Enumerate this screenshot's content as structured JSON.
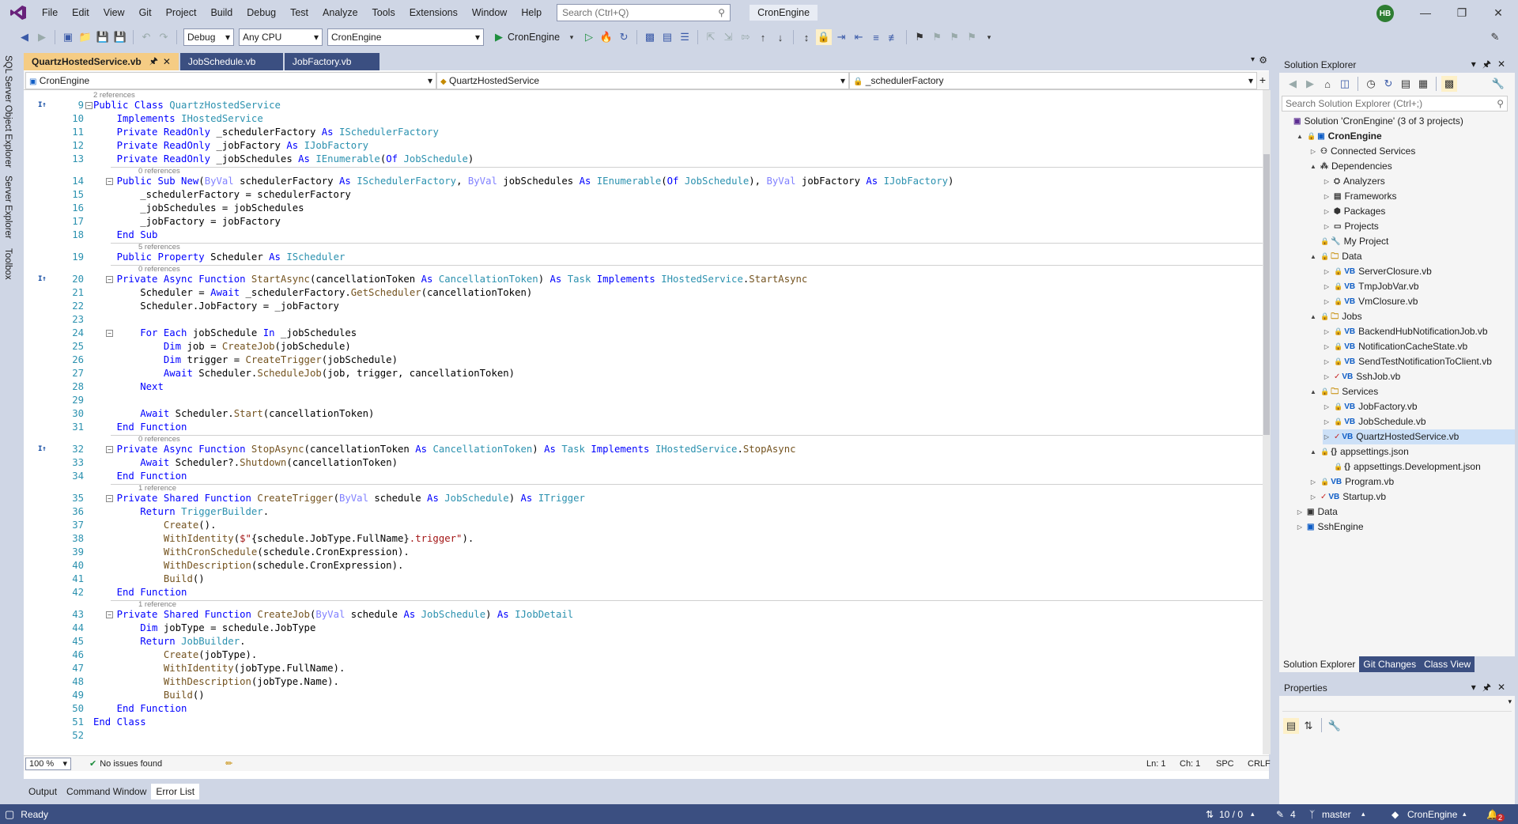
{
  "menu": [
    "File",
    "Edit",
    "View",
    "Git",
    "Project",
    "Build",
    "Debug",
    "Test",
    "Analyze",
    "Tools",
    "Extensions",
    "Window",
    "Help"
  ],
  "search_placeholder": "Search (Ctrl+Q)",
  "solution_badge": "CronEngine",
  "avatar": "HB",
  "toolbar": {
    "config": "Debug",
    "platform": "Any CPU",
    "startup_project": "CronEngine",
    "run_label": "CronEngine"
  },
  "left_tabs": [
    "SQL Server Object Explorer",
    "Server Explorer",
    "Toolbox"
  ],
  "doc_tabs": [
    "QuartzHostedService.vb",
    "JobSchedule.vb",
    "JobFactory.vb"
  ],
  "nav": {
    "project": "CronEngine",
    "type": "QuartzHostedService",
    "member": "_schedulerFactory"
  },
  "code_lines": [
    {
      "n": "9",
      "ref": "2 references",
      "html": "<span class='kw'>Public Class</span> <span class='ty'>QuartzHostedService</span>"
    },
    {
      "n": "10",
      "html": "    <span class='kw'>Implements</span> <span class='ty'>IHostedService</span>"
    },
    {
      "n": "11",
      "html": "    <span class='kw'>Private ReadOnly</span> _schedulerFactory <span class='kw'>As</span> <span class='ty'>ISchedulerFactory</span>"
    },
    {
      "n": "12",
      "html": "    <span class='kw'>Private ReadOnly</span> _jobFactory <span class='kw'>As</span> <span class='ty'>IJobFactory</span>"
    },
    {
      "n": "13",
      "html": "    <span class='kw'>Private ReadOnly</span> _jobSchedules <span class='kw'>As</span> <span class='ty'>IEnumerable</span>(<span class='kw'>Of</span> <span class='ty'>JobSchedule</span>)"
    },
    {
      "n": "14",
      "ref": "0 references",
      "html": "    <span class='kw'>Public Sub New</span>(<span class='dim'>ByVal</span> schedulerFactory <span class='kw'>As</span> <span class='ty'>ISchedulerFactory</span>, <span class='dim'>ByVal</span> jobSchedules <span class='kw'>As</span> <span class='ty'>IEnumerable</span>(<span class='kw'>Of</span> <span class='ty'>JobSchedule</span>), <span class='dim'>ByVal</span> jobFactory <span class='kw'>As</span> <span class='ty'>IJobFactory</span>)"
    },
    {
      "n": "15",
      "html": "        _schedulerFactory = schedulerFactory"
    },
    {
      "n": "16",
      "html": "        _jobSchedules = jobSchedules"
    },
    {
      "n": "17",
      "html": "        _jobFactory = jobFactory"
    },
    {
      "n": "18",
      "html": "    <span class='kw'>End Sub</span>"
    },
    {
      "n": "19",
      "ref": "5 references",
      "html": "    <span class='kw'>Public Property</span> Scheduler <span class='kw'>As</span> <span class='ty'>IScheduler</span>"
    },
    {
      "n": "20",
      "ref": "0 references",
      "html": "    <span class='kw'>Private Async Function</span> <span class='fn'>StartAsync</span>(cancellationToken <span class='kw'>As</span> <span class='ty'>CancellationToken</span>) <span class='kw'>As</span> <span class='ty'>Task</span> <span class='kw'>Implements</span> <span class='ty'>IHostedService</span>.<span class='fn'>StartAsync</span>"
    },
    {
      "n": "21",
      "html": "        Scheduler = <span class='kw'>Await</span> _schedulerFactory.<span class='fn'>GetScheduler</span>(cancellationToken)"
    },
    {
      "n": "22",
      "html": "        Scheduler.JobFactory = _jobFactory"
    },
    {
      "n": "23",
      "html": ""
    },
    {
      "n": "24",
      "html": "        <span class='kw'>For Each</span> jobSchedule <span class='kw'>In</span> _jobSchedules"
    },
    {
      "n": "25",
      "html": "            <span class='kw'>Dim</span> job = <span class='fn'>CreateJob</span>(jobSchedule)"
    },
    {
      "n": "26",
      "html": "            <span class='kw'>Dim</span> trigger = <span class='fn'>CreateTrigger</span>(jobSchedule)"
    },
    {
      "n": "27",
      "html": "            <span class='kw'>Await</span> Scheduler.<span class='fn'>ScheduleJob</span>(job, trigger, cancellationToken)"
    },
    {
      "n": "28",
      "html": "        <span class='kw'>Next</span>"
    },
    {
      "n": "29",
      "html": ""
    },
    {
      "n": "30",
      "html": "        <span class='kw'>Await</span> Scheduler.<span class='fn'>Start</span>(cancellationToken)"
    },
    {
      "n": "31",
      "html": "    <span class='kw'>End Function</span>"
    },
    {
      "n": "32",
      "ref": "0 references",
      "html": "    <span class='kw'>Private Async Function</span> <span class='fn'>StopAsync</span>(cancellationToken <span class='kw'>As</span> <span class='ty'>CancellationToken</span>) <span class='kw'>As</span> <span class='ty'>Task</span> <span class='kw'>Implements</span> <span class='ty'>IHostedService</span>.<span class='fn'>StopAsync</span>"
    },
    {
      "n": "33",
      "html": "        <span class='kw'>Await</span> Scheduler?.<span class='fn'>Shutdown</span>(cancellationToken)"
    },
    {
      "n": "34",
      "html": "    <span class='kw'>End Function</span>"
    },
    {
      "n": "35",
      "ref": "1 reference",
      "html": "    <span class='kw'>Private Shared Function</span> <span class='fn'>CreateTrigger</span>(<span class='dim'>ByVal</span> schedule <span class='kw'>As</span> <span class='ty'>JobSchedule</span>) <span class='kw'>As</span> <span class='ty'>ITrigger</span>"
    },
    {
      "n": "36",
      "html": "        <span class='kw'>Return</span> <span class='ty'>TriggerBuilder</span>."
    },
    {
      "n": "37",
      "html": "            <span class='fn'>Create</span>()."
    },
    {
      "n": "38",
      "html": "            <span class='fn'>WithIdentity</span>(<span class='st'>$\"</span>{schedule.JobType.FullName}<span class='st'>.trigger\"</span>)."
    },
    {
      "n": "39",
      "html": "            <span class='fn'>WithCronSchedule</span>(schedule.CronExpression)."
    },
    {
      "n": "40",
      "html": "            <span class='fn'>WithDescription</span>(schedule.CronExpression)."
    },
    {
      "n": "41",
      "html": "            <span class='fn'>Build</span>()"
    },
    {
      "n": "42",
      "html": "    <span class='kw'>End Function</span>"
    },
    {
      "n": "43",
      "ref": "1 reference",
      "html": "    <span class='kw'>Private Shared Function</span> <span class='fn'>CreateJob</span>(<span class='dim'>ByVal</span> schedule <span class='kw'>As</span> <span class='ty'>JobSchedule</span>) <span class='kw'>As</span> <span class='ty'>IJobDetail</span>"
    },
    {
      "n": "44",
      "html": "        <span class='kw'>Dim</span> jobType = schedule.JobType"
    },
    {
      "n": "45",
      "html": "        <span class='kw'>Return</span> <span class='ty'>JobBuilder</span>."
    },
    {
      "n": "46",
      "html": "            <span class='fn'>Create</span>(jobType)."
    },
    {
      "n": "47",
      "html": "            <span class='fn'>WithIdentity</span>(jobType.FullName)."
    },
    {
      "n": "48",
      "html": "            <span class='fn'>WithDescription</span>(jobType.Name)."
    },
    {
      "n": "49",
      "html": "            <span class='fn'>Build</span>()"
    },
    {
      "n": "50",
      "html": "    <span class='kw'>End Function</span>"
    },
    {
      "n": "51",
      "html": "<span class='kw'>End Class</span>"
    },
    {
      "n": "52",
      "html": ""
    }
  ],
  "editor_status": {
    "zoom": "100 %",
    "issues": "No issues found",
    "ln": "Ln: 1",
    "ch": "Ch: 1",
    "spc": "SPC",
    "crlf": "CRLF"
  },
  "bottom_tabs": [
    "Output",
    "Command Window",
    "Error List"
  ],
  "solution_explorer": {
    "title": "Solution Explorer",
    "search": "Search Solution Explorer (Ctrl+;)",
    "tree": [
      {
        "d": 0,
        "e": "",
        "icon": "sln",
        "label": "Solution 'CronEngine' (3 of 3 projects)"
      },
      {
        "d": 1,
        "e": "▲",
        "icon": "proj",
        "label": "CronEngine",
        "bold": true
      },
      {
        "d": 2,
        "e": "▷",
        "icon": "conn",
        "label": "Connected Services"
      },
      {
        "d": 2,
        "e": "▲",
        "icon": "dep",
        "label": "Dependencies"
      },
      {
        "d": 3,
        "e": "▷",
        "icon": "an",
        "label": "Analyzers"
      },
      {
        "d": 3,
        "e": "▷",
        "icon": "fw",
        "label": "Frameworks"
      },
      {
        "d": 3,
        "e": "▷",
        "icon": "pkg",
        "label": "Packages"
      },
      {
        "d": 3,
        "e": "▷",
        "icon": "prj",
        "label": "Projects"
      },
      {
        "d": 2,
        "e": "",
        "icon": "wrench",
        "label": "My Project"
      },
      {
        "d": 2,
        "e": "▲",
        "icon": "folder",
        "label": "Data"
      },
      {
        "d": 3,
        "e": "▷",
        "icon": "vb",
        "label": "ServerClosure.vb"
      },
      {
        "d": 3,
        "e": "▷",
        "icon": "vb",
        "label": "TmpJobVar.vb"
      },
      {
        "d": 3,
        "e": "▷",
        "icon": "vb",
        "label": "VmClosure.vb"
      },
      {
        "d": 2,
        "e": "▲",
        "icon": "folder",
        "label": "Jobs"
      },
      {
        "d": 3,
        "e": "▷",
        "icon": "vb",
        "label": "BackendHubNotificationJob.vb"
      },
      {
        "d": 3,
        "e": "▷",
        "icon": "vb",
        "label": "NotificationCacheState.vb"
      },
      {
        "d": 3,
        "e": "▷",
        "icon": "vb",
        "label": "SendTestNotificationToClient.vb"
      },
      {
        "d": 3,
        "e": "▷",
        "icon": "vbc",
        "label": "SshJob.vb"
      },
      {
        "d": 2,
        "e": "▲",
        "icon": "folder",
        "label": "Services"
      },
      {
        "d": 3,
        "e": "▷",
        "icon": "vb",
        "label": "JobFactory.vb"
      },
      {
        "d": 3,
        "e": "▷",
        "icon": "vb",
        "label": "JobSchedule.vb"
      },
      {
        "d": 3,
        "e": "▷",
        "icon": "vbc",
        "label": "QuartzHostedService.vb",
        "sel": true
      },
      {
        "d": 2,
        "e": "▲",
        "icon": "json",
        "label": "appsettings.json"
      },
      {
        "d": 3,
        "e": "",
        "icon": "json",
        "label": "appsettings.Development.json"
      },
      {
        "d": 2,
        "e": "▷",
        "icon": "vbp",
        "label": "Program.vb"
      },
      {
        "d": 2,
        "e": "▷",
        "icon": "vbc",
        "label": "Startup.vb"
      },
      {
        "d": 1,
        "e": "▷",
        "icon": "projg",
        "label": "Data"
      },
      {
        "d": 1,
        "e": "▷",
        "icon": "projvb",
        "label": "SshEngine"
      }
    ],
    "tabs": [
      "Solution Explorer",
      "Git Changes",
      "Class View"
    ]
  },
  "properties_title": "Properties",
  "statusbar": {
    "ready": "Ready",
    "updown": "10 / 0",
    "pencil": "4",
    "branch": "master",
    "repo": "CronEngine",
    "notif": "2"
  }
}
